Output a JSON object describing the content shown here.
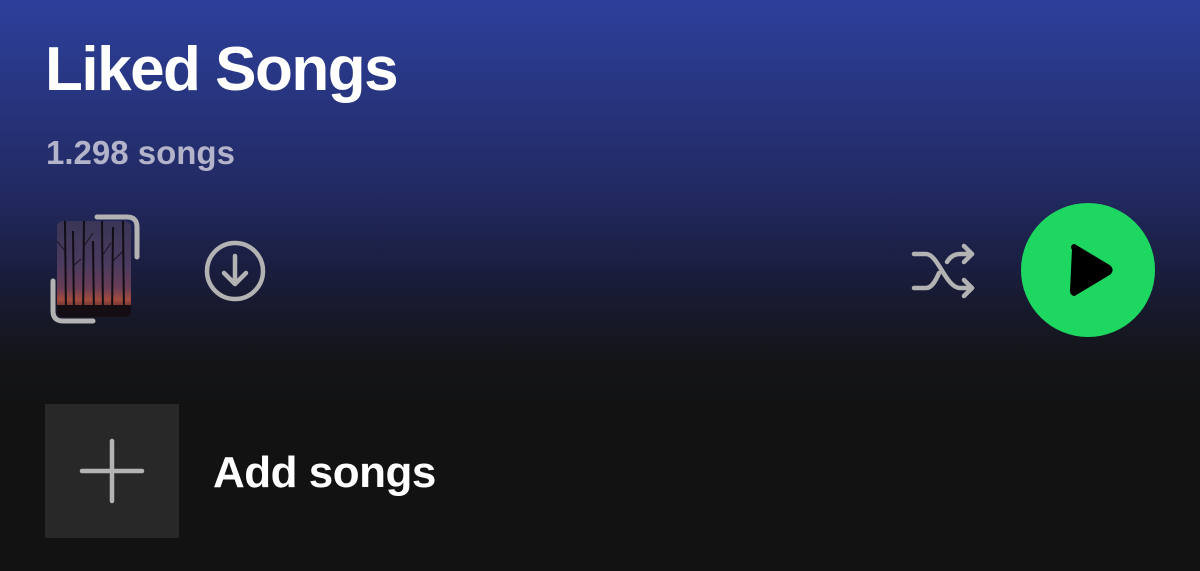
{
  "header": {
    "title": "Liked Songs",
    "song_count": "1.298 songs"
  },
  "actions": {
    "cover_icon": "cover-thumbnail-icon",
    "download_icon": "download-icon",
    "shuffle_icon": "shuffle-icon",
    "play_icon": "play-icon",
    "play_color": "#1ed760"
  },
  "list": {
    "add_songs_label": "Add songs",
    "add_icon": "plus-icon"
  }
}
